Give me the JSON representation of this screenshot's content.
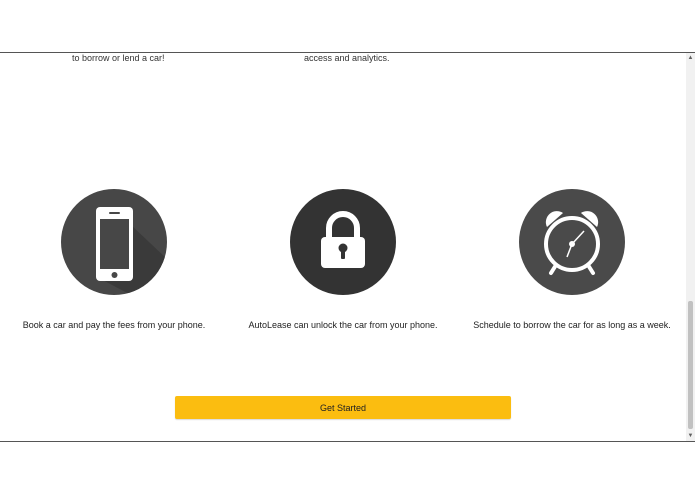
{
  "partial_texts": {
    "left": "to borrow or lend a car!",
    "middle": "access and analytics."
  },
  "features": [
    {
      "icon": "smartphone-icon",
      "text": "Book a car and pay the fees from your phone."
    },
    {
      "icon": "padlock-icon",
      "text": "AutoLease can unlock the car from your phone."
    },
    {
      "icon": "alarm-clock-icon",
      "text": "Schedule to borrow the car for as long as a week."
    }
  ],
  "cta": {
    "label": "Get Started"
  },
  "colors": {
    "accent": "#fbbd10",
    "icon_circle_phone": "#474747",
    "icon_circle_lock": "#333333",
    "icon_circle_clock": "#4a4a4a",
    "icon_fill": "#ffffff"
  },
  "scrollbar": {
    "up_glyph": "▲",
    "down_glyph": "▼"
  }
}
